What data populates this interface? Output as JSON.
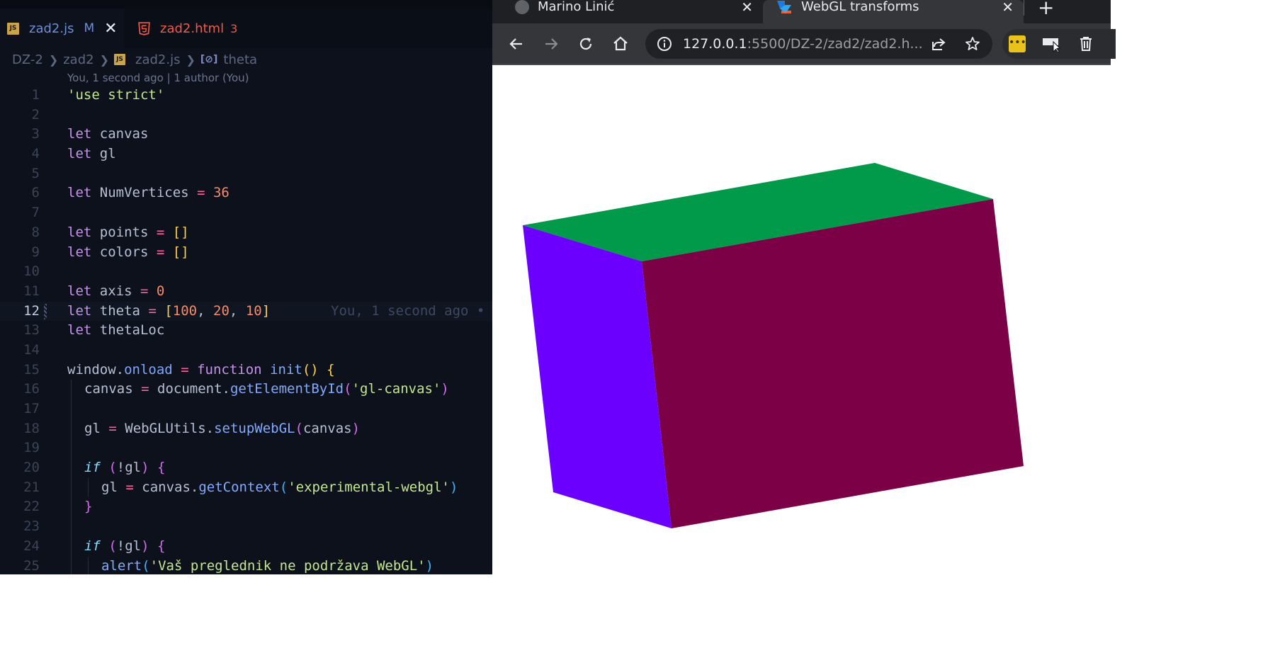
{
  "editor": {
    "tabs": [
      {
        "label": "zad2.js",
        "badge": "JS",
        "status": "M",
        "active": true
      },
      {
        "label": "zad2.html",
        "count": "3",
        "active": false
      }
    ],
    "breadcrumb": [
      "DZ-2",
      "zad2",
      "zad2.js",
      "theta"
    ],
    "blame_header": "You, 1 second ago | 1 author (You)",
    "current_line_blame": "You, 1 second ago •",
    "line_numbers": [
      "1",
      "2",
      "3",
      "4",
      "5",
      "6",
      "7",
      "8",
      "9",
      "10",
      "11",
      "12",
      "13",
      "14",
      "15",
      "16",
      "17",
      "18",
      "19",
      "20",
      "21",
      "22",
      "23",
      "24",
      "25"
    ],
    "code": {
      "l1": "'use strict'",
      "l3": [
        "let",
        "canvas"
      ],
      "l4": [
        "let",
        "gl"
      ],
      "l6": [
        "let",
        "NumVertices",
        "=",
        "36"
      ],
      "l8": [
        "let",
        "points",
        "=",
        "[]"
      ],
      "l9": [
        "let",
        "colors",
        "=",
        "[]"
      ],
      "l11": [
        "let",
        "axis",
        "=",
        "0"
      ],
      "l12": [
        "let",
        "theta",
        "=",
        "[",
        "100",
        ",",
        "20",
        ",",
        "10",
        "]"
      ],
      "l13": [
        "let",
        "thetaLoc"
      ],
      "l15": [
        "window",
        ".",
        "onload",
        "=",
        "function",
        "init",
        "()",
        "{"
      ],
      "l16": [
        "canvas",
        "=",
        "document",
        ".",
        "getElementById",
        "(",
        "'gl-canvas'",
        ")"
      ],
      "l18": [
        "gl",
        "=",
        "WebGLUtils",
        ".",
        "setupWebGL",
        "(",
        "canvas",
        ")"
      ],
      "l20": [
        "if",
        "(",
        "!gl",
        ")",
        "{"
      ],
      "l21": [
        "gl",
        "=",
        "canvas",
        ".",
        "getContext",
        "(",
        "'experimental-webgl'",
        ")"
      ],
      "l22": "}",
      "l24": [
        "if",
        "(",
        "!gl",
        ")",
        "{"
      ],
      "l25": [
        "alert",
        "(",
        "'Vaš preglednik ne podržava WebGL'",
        ")"
      ]
    }
  },
  "browser": {
    "tabs": [
      {
        "title": "Marino Linić",
        "icon": "globe-icon",
        "close": "✕"
      },
      {
        "title": "WebGL transforms",
        "icon": "vscode-live-icon",
        "close": "✕",
        "active": true
      }
    ],
    "new_tab": "+",
    "url_host": "127.0.0.1",
    "url_rest": ":5500/DZ-2/zad2/zad2.h...",
    "cube": {
      "colors": {
        "top": "#009a4a",
        "left": "#6b00ff",
        "front": "#7b0046"
      },
      "rotation_theta": [
        100,
        20,
        10
      ]
    }
  },
  "colors": {
    "editor_bg": "#0c111b",
    "keyword": "#c792ea",
    "string": "#c3e88d",
    "number": "#f78c6c",
    "chrome_toolbar": "#35363a"
  }
}
